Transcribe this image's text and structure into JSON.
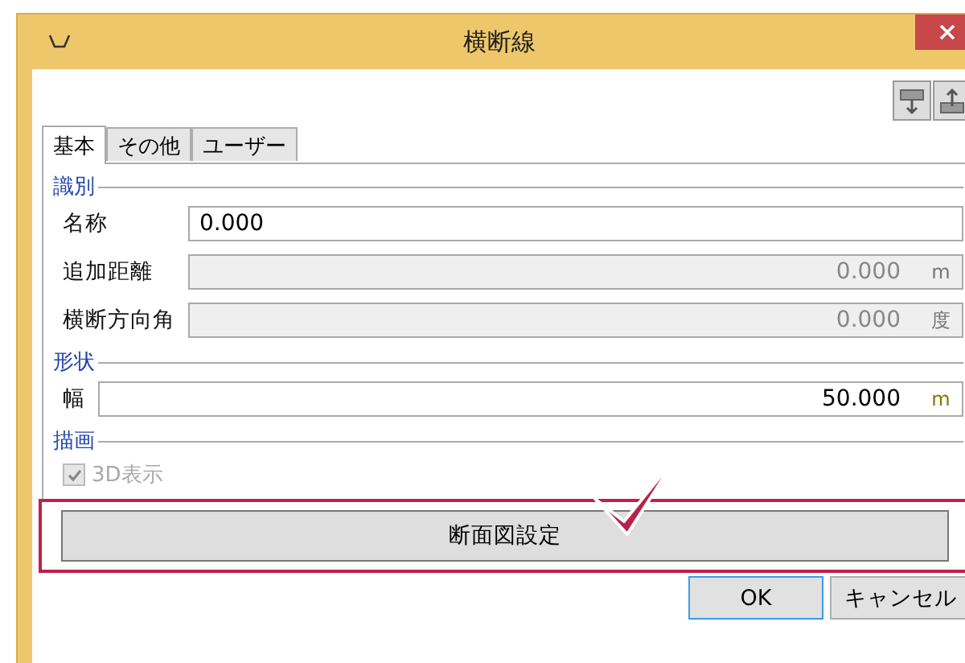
{
  "window": {
    "title": "横断線"
  },
  "tabs": [
    {
      "label": "基本",
      "selected": true
    },
    {
      "label": "その他",
      "selected": false
    },
    {
      "label": "ユーザー",
      "selected": false
    }
  ],
  "sections": [
    {
      "title": "識別",
      "fields": [
        {
          "kind": "text",
          "label": "名称",
          "value": "0.000",
          "disabled": false
        },
        {
          "kind": "text",
          "label": "追加距離",
          "value": "0.000",
          "unit": "m",
          "disabled": true
        },
        {
          "kind": "text",
          "label": "横断方向角",
          "value": "0.000",
          "unit": "度",
          "disabled": true
        }
      ]
    },
    {
      "title": "形状",
      "fields": [
        {
          "kind": "text",
          "label": "幅",
          "value": "50.000",
          "unit": "m",
          "disabled": false
        }
      ]
    },
    {
      "title": "描画",
      "fields": [
        {
          "kind": "checkbox",
          "label": "3D表示",
          "checked": true,
          "disabled": true
        }
      ]
    }
  ],
  "section_button": {
    "label": "断面図設定",
    "highlighted": true
  },
  "buttons": [
    {
      "label": "OK",
      "default": true
    },
    {
      "label": "キャンセル",
      "default": false
    }
  ]
}
